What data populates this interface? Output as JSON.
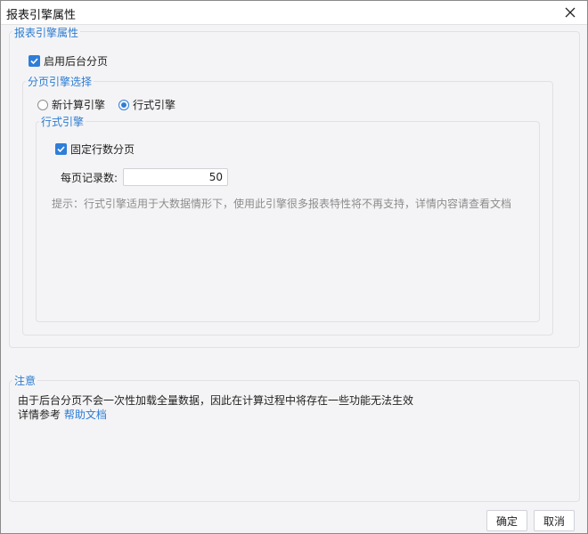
{
  "window": {
    "title": "报表引擎属性"
  },
  "engine_properties": {
    "legend": "报表引擎属性",
    "enable_background_paging": {
      "label": "启用后台分页",
      "checked": true
    }
  },
  "paging_engine": {
    "legend": "分页引擎选择",
    "options": [
      {
        "label": "新计算引擎",
        "selected": false
      },
      {
        "label": "行式引擎",
        "selected": true
      }
    ]
  },
  "row_engine": {
    "legend": "行式引擎",
    "fixed_rows": {
      "label": "固定行数分页",
      "checked": true
    },
    "records_per_page": {
      "label": "每页记录数:",
      "value": "50"
    },
    "hint": "提示：行式引擎适用于大数据情形下，使用此引擎很多报表特性将不再支持，详情内容请查看文档"
  },
  "notice": {
    "legend": "注意",
    "line1": "由于后台分页不会一次性加载全量数据，因此在计算过程中将存在一些功能无法生效",
    "line2_prefix": "详情参考",
    "help_link": "帮助文档"
  },
  "buttons": {
    "ok": "确定",
    "cancel": "取消"
  },
  "colors": {
    "accent": "#2f7ed8",
    "legend": "#2c7cd1"
  }
}
